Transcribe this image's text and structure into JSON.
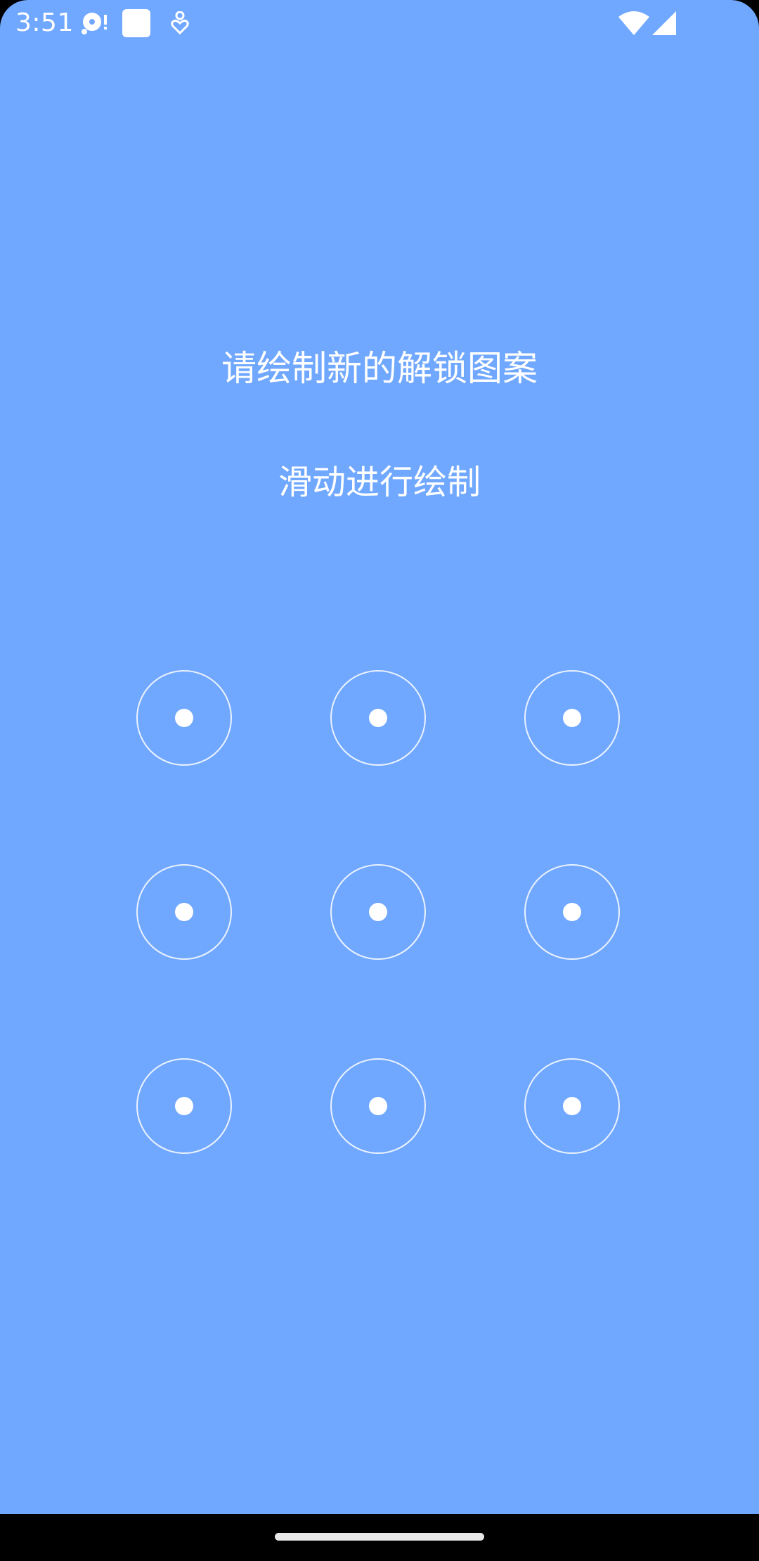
{
  "status_bar": {
    "time": "3:51",
    "icons": [
      "media-notification-icon",
      "square-notification-icon",
      "accessibility-heart-icon",
      "wifi-icon",
      "cellular-signal-icon"
    ]
  },
  "lock_pattern": {
    "title": "请绘制新的解锁图案",
    "subtitle": "滑动进行绘制",
    "nodes": [
      1,
      2,
      3,
      4,
      5,
      6,
      7,
      8,
      9
    ]
  },
  "colors": {
    "background": "#71a8ff",
    "foreground": "#ffffff",
    "nav_bar": "#000000"
  }
}
